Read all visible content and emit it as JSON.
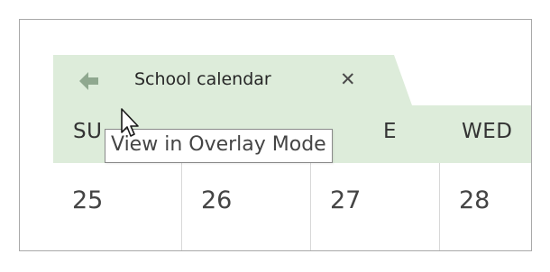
{
  "calendar_tab": {
    "title": "School calendar",
    "back_icon": "arrow-left-icon",
    "close_icon": "close-icon",
    "close_glyph": "✕",
    "tab_color": "#ddecda"
  },
  "day_headers": [
    "SU",
    "E",
    "WED"
  ],
  "dates": [
    "25",
    "26",
    "27",
    "28"
  ],
  "tooltip": {
    "text": "View in Overlay Mode"
  }
}
